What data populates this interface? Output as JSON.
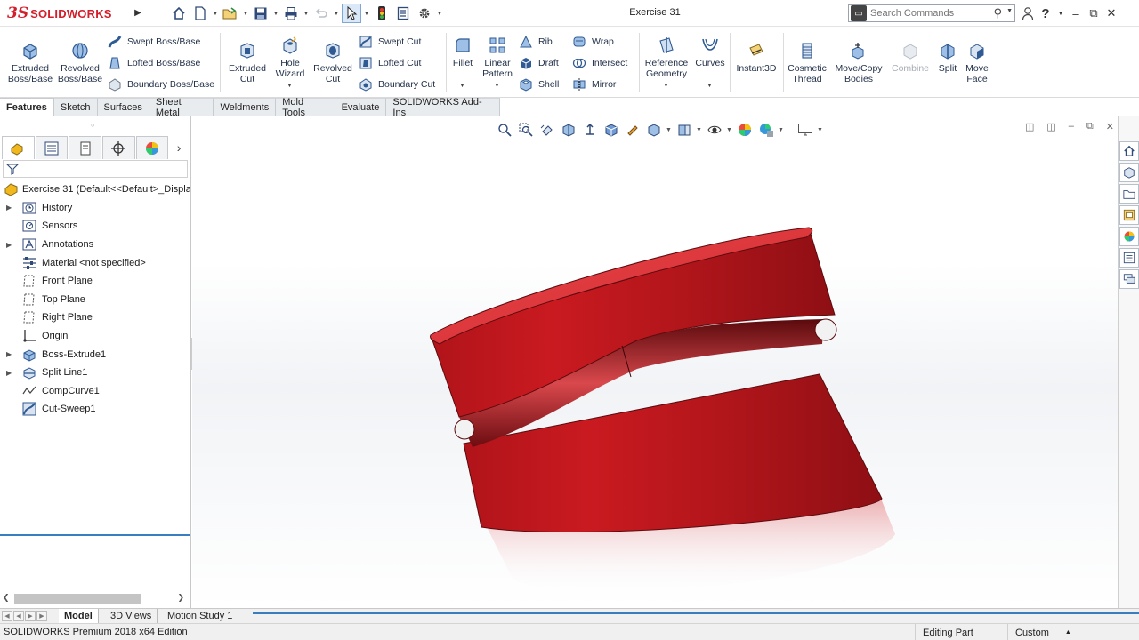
{
  "app": {
    "brand_ds": "3S",
    "brand_name": "SOLIDWORKS",
    "doc_title": "Exercise 31",
    "search_placeholder": "Search Commands",
    "help_icon": "?"
  },
  "ribbon": {
    "extruded_boss": "Extruded Boss/Base",
    "revolved_boss": "Revolved Boss/Base",
    "swept_boss": "Swept Boss/Base",
    "lofted_boss": "Lofted Boss/Base",
    "boundary_boss": "Boundary Boss/Base",
    "extruded_cut": "Extruded Cut",
    "hole_wizard": "Hole Wizard",
    "revolved_cut": "Revolved Cut",
    "swept_cut": "Swept Cut",
    "lofted_cut": "Lofted Cut",
    "boundary_cut": "Boundary Cut",
    "fillet": "Fillet",
    "linear_pattern": "Linear Pattern",
    "rib": "Rib",
    "draft": "Draft",
    "shell": "Shell",
    "wrap": "Wrap",
    "intersect": "Intersect",
    "mirror": "Mirror",
    "reference_geometry": "Reference Geometry",
    "curves": "Curves",
    "instant3d": "Instant3D",
    "cosmetic_thread": "Cosmetic Thread",
    "move_copy": "Move/Copy Bodies",
    "combine": "Combine",
    "split": "Split",
    "move_face": "Move Face"
  },
  "cmd_tabs": [
    "Features",
    "Sketch",
    "Surfaces",
    "Sheet Metal",
    "Weldments",
    "Mold Tools",
    "Evaluate",
    "SOLIDWORKS Add-Ins"
  ],
  "tree": {
    "root": "Exercise 31  (Default<<Default>_Displa",
    "items": [
      "History",
      "Sensors",
      "Annotations",
      "Material <not specified>",
      "Front Plane",
      "Top Plane",
      "Right Plane",
      "Origin",
      "Boss-Extrude1",
      "Split Line1",
      "CompCurve1",
      "Cut-Sweep1"
    ]
  },
  "bottom_tabs": [
    "Model",
    "3D Views",
    "Motion Study 1"
  ],
  "status": {
    "edition": "SOLIDWORKS Premium 2018 x64 Edition",
    "mode": "Editing Part",
    "units": "Custom"
  },
  "colors": {
    "brand_red": "#d31e2b",
    "part_red": "#c8181c",
    "selection_blue": "#3a7ebf"
  }
}
